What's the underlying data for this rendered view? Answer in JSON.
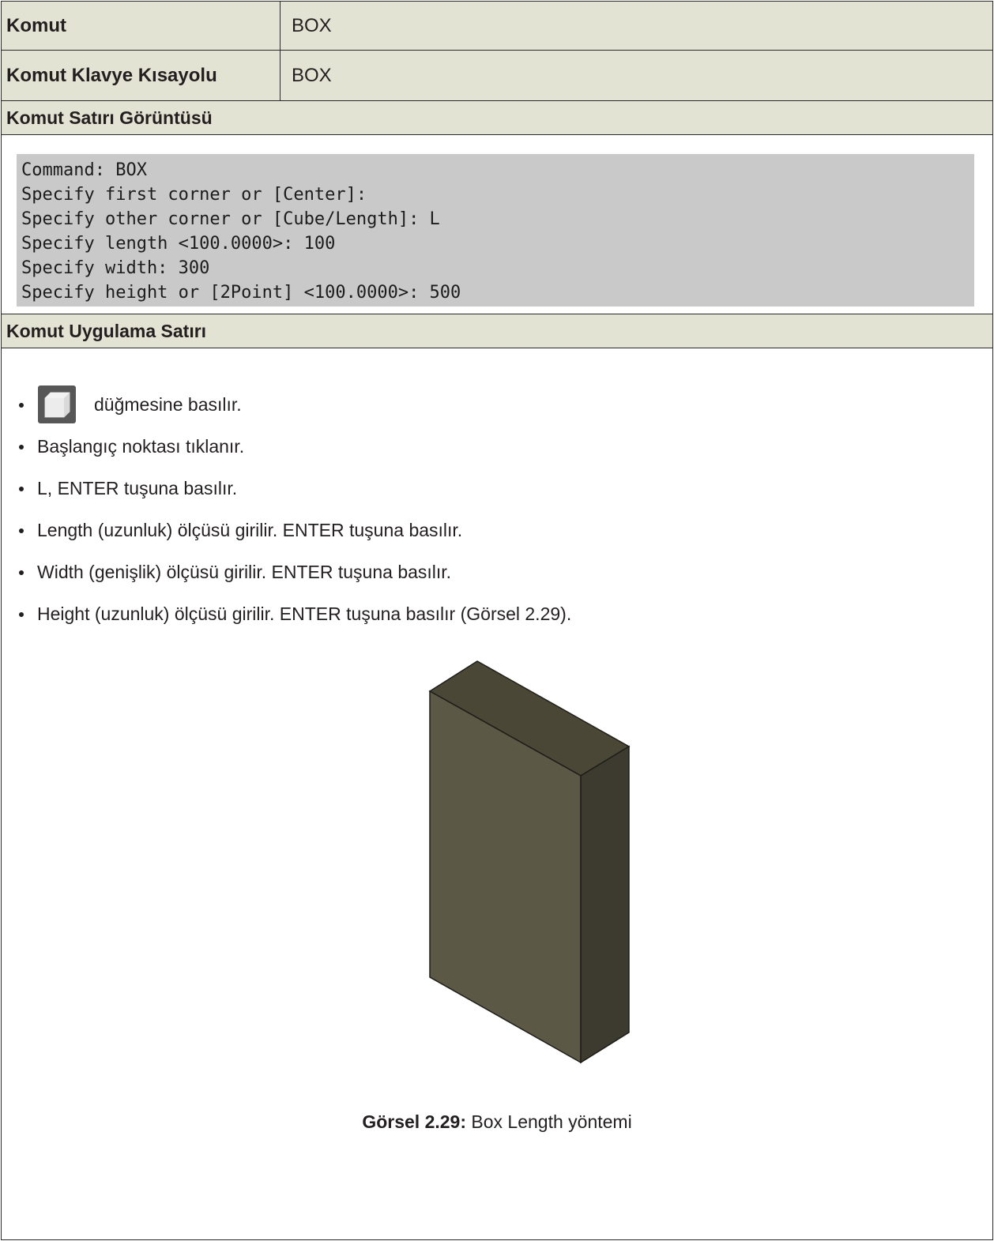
{
  "table": {
    "command_label": "Komut",
    "command_value": "BOX",
    "shortcut_label": "Komut Klavye Kısayolu",
    "shortcut_value": "BOX",
    "cmdline_heading": "Komut Satırı Görüntüsü",
    "apply_heading": "Komut Uygulama Satırı"
  },
  "command_lines": [
    "Command: BOX",
    "Specify first corner or [Center]:",
    "Specify other corner or [Cube/Length]: L",
    "Specify length <100.0000>: 100",
    "Specify width: 300",
    "Specify height or [2Point] <100.0000>: 500"
  ],
  "steps": [
    "düğmesine basılır.",
    "Başlangıç noktası tıklanır.",
    "L, ENTER tuşuna basılır.",
    "Length (uzunluk) ölçüsü girilir. ENTER tuşuna basılır.",
    "Width (genişlik) ölçüsü girilir. ENTER tuşuna basılır.",
    "Height (uzunluk) ölçüsü girilir. ENTER tuşuna basılır (Görsel 2.29)."
  ],
  "button_icon": "box-tool-icon",
  "figure": {
    "caption_label": "Görsel 2.29:",
    "caption_text": " Box Length yöntemi"
  },
  "colors": {
    "header_bg": "#e3e3d3",
    "cmd_bg": "#c9c9c9",
    "box_front": "#5c5846",
    "box_top": "#4b4737",
    "box_side": "#3d3a30"
  }
}
